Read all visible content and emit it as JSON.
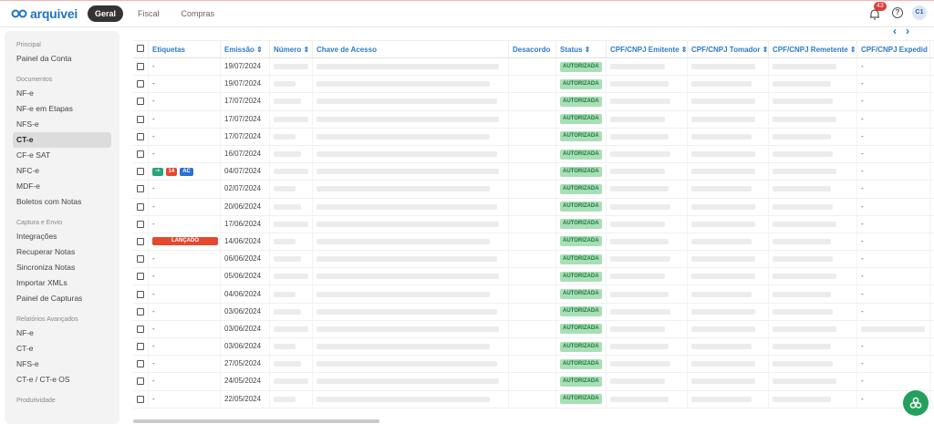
{
  "app": {
    "logo_text": "arquivei"
  },
  "topnav": {
    "tabs": [
      "Geral",
      "Fiscal",
      "Compras"
    ],
    "active": "Geral"
  },
  "header": {
    "notifications": "43",
    "help": "?",
    "avatar": "C1"
  },
  "sidebar": {
    "sections": [
      {
        "title": "Principal",
        "items": [
          "Painel da Conta"
        ]
      },
      {
        "title": "Documentos",
        "items": [
          "NF-e",
          "NF-e em Etapas",
          "NFS-e",
          "CT-e",
          "CF-e SAT",
          "NFC-e",
          "MDF-e",
          "Boletos com Notas"
        ]
      },
      {
        "title": "Captura e Envio",
        "items": [
          "Integrações",
          "Recuperar Notas",
          "Sincroniza Notas",
          "Importar XMLs",
          "Painel de Capturas"
        ]
      },
      {
        "title": "Relatórios Avançados",
        "items": [
          "NF-e",
          "CT-e",
          "NFS-e",
          "CT-e / CT-e OS"
        ]
      },
      {
        "title": "Produtividade",
        "items": []
      }
    ],
    "active_item": "CT-e"
  },
  "table": {
    "headers": [
      "Etiquetas",
      "Emissão ⇕",
      "Número ⇕",
      "Chave de Acesso",
      "Desacordo",
      "Status ⇕",
      "CPF/CNPJ Emitente ⇕",
      "CPF/CNPJ Tomador ⇕",
      "CPF/CNPJ Remetente ⇕",
      "CPF/CNPJ Expedid"
    ],
    "status_label": "AUTORIZADA",
    "rows": [
      {
        "tag": "-",
        "date": "19/07/2024",
        "exp": "-"
      },
      {
        "tag": "-",
        "date": "19/07/2024",
        "exp": "-"
      },
      {
        "tag": "-",
        "date": "17/07/2024",
        "exp": "-"
      },
      {
        "tag": "-",
        "date": "17/07/2024",
        "exp": "-"
      },
      {
        "tag": "-",
        "date": "17/07/2024",
        "exp": "-"
      },
      {
        "tag": "-",
        "date": "16/07/2024",
        "exp": "-"
      },
      {
        "tag": "chips",
        "date": "04/07/2024",
        "exp": "-"
      },
      {
        "tag": "-",
        "date": "02/07/2024",
        "exp": "-"
      },
      {
        "tag": "-",
        "date": "20/06/2024",
        "exp": "-"
      },
      {
        "tag": "-",
        "date": "17/06/2024",
        "exp": "-"
      },
      {
        "tag": "lancado",
        "date": "14/06/2024",
        "exp": "-"
      },
      {
        "tag": "-",
        "date": "06/06/2024",
        "exp": "-"
      },
      {
        "tag": "-",
        "date": "05/06/2024",
        "exp": "-"
      },
      {
        "tag": "-",
        "date": "04/06/2024",
        "exp": "-"
      },
      {
        "tag": "-",
        "date": "03/06/2024",
        "exp": "-"
      },
      {
        "tag": "-",
        "date": "03/06/2024",
        "exp": "blur"
      },
      {
        "tag": "-",
        "date": "03/06/2024",
        "exp": "-"
      },
      {
        "tag": "-",
        "date": "27/05/2024",
        "exp": "-"
      },
      {
        "tag": "-",
        "date": "24/05/2024",
        "exp": "-"
      },
      {
        "tag": "-",
        "date": "22/05/2024",
        "exp": "-"
      }
    ],
    "tag_chips": [
      "-+",
      "14",
      "AC"
    ],
    "tag_lancado": "LANÇADO"
  },
  "pager": {
    "prev": "‹",
    "next": "›"
  },
  "colors": {
    "accent": "#1e74c6",
    "status_bg": "#a8dfb7",
    "fab": "#23a05b"
  }
}
